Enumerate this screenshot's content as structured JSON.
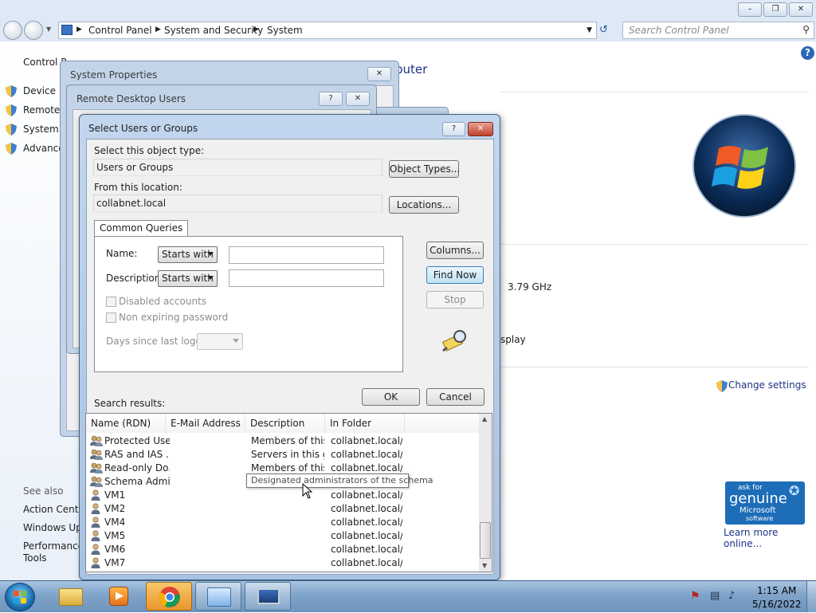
{
  "control_panel": {
    "breadcrumbs": [
      "Control Panel",
      "System and Security",
      "System"
    ],
    "search_placeholder": "Search Control Panel",
    "left_pane": {
      "home_link": "Control P",
      "tasks": [
        "Device M",
        "Remote s",
        "System p",
        "Advance"
      ],
      "see_also_header": "See also",
      "see_also": [
        "Action Cente",
        "Windows Upd",
        "Performance",
        "Tools"
      ]
    },
    "heading_fragment": "puter",
    "processor_speed": "3.79 GHz",
    "display_fragment": "splay",
    "change_settings": "Change settings",
    "genuine": {
      "line1": "ask for",
      "line2": "genuine",
      "line3": "Microsoft",
      "line4": "software"
    },
    "learn_more": "Learn more online..."
  },
  "system_properties": {
    "title": "System Properties"
  },
  "remote_desktop_users": {
    "title": "Remote Desktop Users",
    "help": "?"
  },
  "select_dialog": {
    "title": "Select Users or Groups",
    "help": "?",
    "object_type_label": "Select this object type:",
    "object_type_value": "Users or Groups",
    "object_types_button": "Object Types...",
    "location_label": "From this location:",
    "location_value": "collabnet.local",
    "locations_button": "Locations...",
    "tab_label": "Common Queries",
    "name_label": "Name:",
    "name_mode": "Starts with",
    "description_label": "Description:",
    "description_mode": "Starts with",
    "disabled_accounts": "Disabled accounts",
    "non_expiring": "Non expiring password",
    "days_since": "Days since last logon:",
    "columns_button": "Columns...",
    "find_now_button": "Find Now",
    "stop_button": "Stop",
    "ok_button": "OK",
    "cancel_button": "Cancel",
    "search_results_label": "Search results:",
    "columns": [
      "Name (RDN)",
      "E-Mail Address",
      "Description",
      "In Folder"
    ],
    "rows": [
      {
        "name": "Protected Users",
        "email": "",
        "description": "Members of this ...",
        "folder": "collabnet.local/...",
        "type": "group"
      },
      {
        "name": "RAS and IAS ...",
        "email": "",
        "description": "Servers in this gr...",
        "folder": "collabnet.local/...",
        "type": "group"
      },
      {
        "name": "Read-only Do...",
        "email": "",
        "description": "Members of this ...",
        "folder": "collabnet.local/...",
        "type": "group"
      },
      {
        "name": "Schema Admins",
        "email": "",
        "description": "",
        "folder": "",
        "type": "group"
      },
      {
        "name": "VM1",
        "email": "",
        "description": "",
        "folder": "collabnet.local/...",
        "type": "user"
      },
      {
        "name": "VM2",
        "email": "",
        "description": "",
        "folder": "collabnet.local/...",
        "type": "user"
      },
      {
        "name": "VM4",
        "email": "",
        "description": "",
        "folder": "collabnet.local/...",
        "type": "user"
      },
      {
        "name": "VM5",
        "email": "",
        "description": "",
        "folder": "collabnet.local/...",
        "type": "user"
      },
      {
        "name": "VM6",
        "email": "",
        "description": "",
        "folder": "collabnet.local/...",
        "type": "user"
      },
      {
        "name": "VM7",
        "email": "",
        "description": "",
        "folder": "collabnet.local/...",
        "type": "user"
      }
    ],
    "tooltip": "Designated administrators of the schema"
  },
  "taskbar": {
    "time": "1:15 AM",
    "date": "5/16/2022"
  }
}
